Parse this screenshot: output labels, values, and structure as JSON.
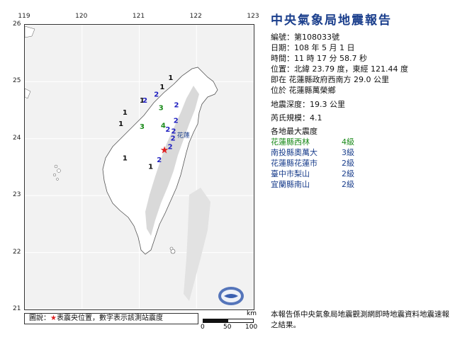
{
  "title": "中央氣象局地震報告",
  "report": {
    "number_label": "編號：",
    "number_value": "第108033號",
    "date_label": "日期：",
    "date_value": "108 年 5 月 1 日",
    "time_label": "時間：",
    "time_value": "11 時 17 分 58.7 秒",
    "position_label": "位置：",
    "position_value": "北緯 23.79 度，東經 121.44 度",
    "position_line2": "即在 花蓮縣政府西南方 29.0 公里",
    "position_line3": "位於 花蓮縣萬榮鄉",
    "depth_label": "地震深度：",
    "depth_value": "19.3 公里",
    "magnitude_label": "芮氏規模：",
    "magnitude_value": "4.1",
    "max_intensity_header": "各地最大震度"
  },
  "stations": [
    {
      "name": "花蓮縣西林",
      "level": "4級",
      "color": "#1a8a1a"
    },
    {
      "name": "南投縣奧萬大",
      "level": "3級",
      "color": "#1a3e8c"
    },
    {
      "name": "花蓮縣花蓮市",
      "level": "2級",
      "color": "#1a3e8c"
    },
    {
      "name": "臺中市梨山",
      "level": "2級",
      "color": "#1a3e8c"
    },
    {
      "name": "宜蘭縣南山",
      "level": "2級",
      "color": "#1a3e8c"
    }
  ],
  "map": {
    "lon_ticks": [
      "119",
      "120",
      "121",
      "122",
      "123"
    ],
    "lat_ticks": [
      "26",
      "25",
      "24",
      "23",
      "22",
      "21"
    ],
    "city_label": "花蓮",
    "intensities": [
      {
        "v": "1",
        "lon": 121.55,
        "lat": 25.06,
        "c": "#111"
      },
      {
        "v": "1",
        "lon": 121.4,
        "lat": 24.9,
        "c": "#111"
      },
      {
        "v": "2",
        "lon": 121.3,
        "lat": 24.77,
        "c": "#2020c0"
      },
      {
        "v": "1",
        "lon": 121.05,
        "lat": 24.66,
        "c": "#111"
      },
      {
        "v": "2",
        "lon": 121.1,
        "lat": 24.66,
        "c": "#2020c0"
      },
      {
        "v": "2",
        "lon": 121.65,
        "lat": 24.58,
        "c": "#2020c0"
      },
      {
        "v": "3",
        "lon": 121.38,
        "lat": 24.53,
        "c": "#1a8a1a"
      },
      {
        "v": "2",
        "lon": 121.64,
        "lat": 24.31,
        "c": "#2020c0"
      },
      {
        "v": "1",
        "lon": 120.75,
        "lat": 24.45,
        "c": "#111"
      },
      {
        "v": "1",
        "lon": 120.68,
        "lat": 24.25,
        "c": "#111"
      },
      {
        "v": "3",
        "lon": 121.05,
        "lat": 24.2,
        "c": "#1a8a1a"
      },
      {
        "v": "4",
        "lon": 121.42,
        "lat": 24.22,
        "c": "#1a8a1a"
      },
      {
        "v": "2",
        "lon": 121.5,
        "lat": 24.15,
        "c": "#2020c0"
      },
      {
        "v": "2",
        "lon": 121.6,
        "lat": 24.12,
        "c": "#2020c0"
      },
      {
        "v": "2",
        "lon": 121.59,
        "lat": 24.0,
        "c": "#2020c0"
      },
      {
        "v": "2",
        "lon": 121.54,
        "lat": 23.85,
        "c": "#2020c0"
      },
      {
        "v": "1",
        "lon": 120.75,
        "lat": 23.65,
        "c": "#111"
      },
      {
        "v": "2",
        "lon": 121.35,
        "lat": 23.62,
        "c": "#2020c0"
      },
      {
        "v": "1",
        "lon": 121.2,
        "lat": 23.5,
        "c": "#111"
      }
    ],
    "epicenter": {
      "lon": 121.44,
      "lat": 23.79
    }
  },
  "legend": {
    "prefix": "圖說：",
    "star": "★",
    "text": "表震央位置，數字表示該測站震度"
  },
  "scale_bar": {
    "unit": "km",
    "labels": [
      "0",
      "50",
      "100"
    ]
  },
  "footnote": "本報告係中央氣象局地震觀測網即時地震資料地震速報之結果。",
  "colors": {
    "title": "#1a3e8c",
    "epicenter": "#e02020"
  }
}
